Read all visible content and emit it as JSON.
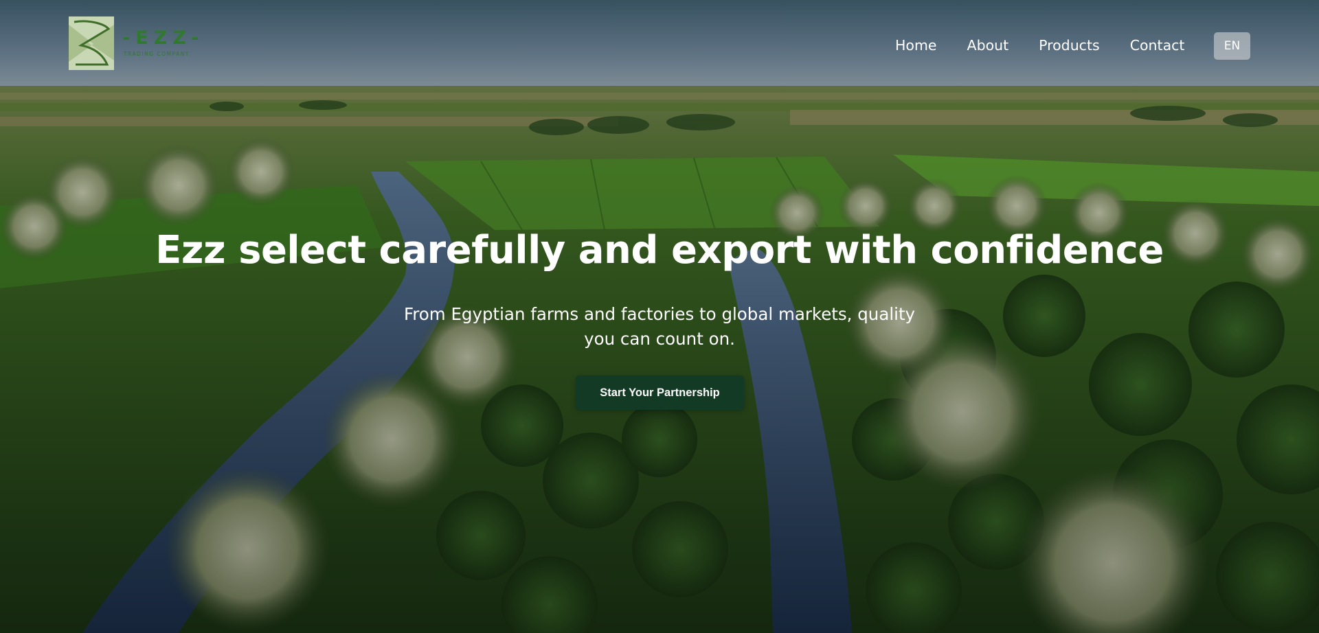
{
  "brand": {
    "name": "-EZZ-",
    "tagline": "TRADING COMPANY",
    "color": "#2f7a2f"
  },
  "nav": {
    "items": [
      {
        "label": "Home"
      },
      {
        "label": "About"
      },
      {
        "label": "Products"
      },
      {
        "label": "Contact"
      }
    ],
    "language": "EN"
  },
  "hero": {
    "title": "Ezz select carefully and export with confidence",
    "subtitle": "From Egyptian farms and factories to global markets, quality you can count on.",
    "cta_label": "Start Your Partnership",
    "cta_color": "#123a24",
    "background": "aerial-farmland-palm-trees-canal-image"
  }
}
